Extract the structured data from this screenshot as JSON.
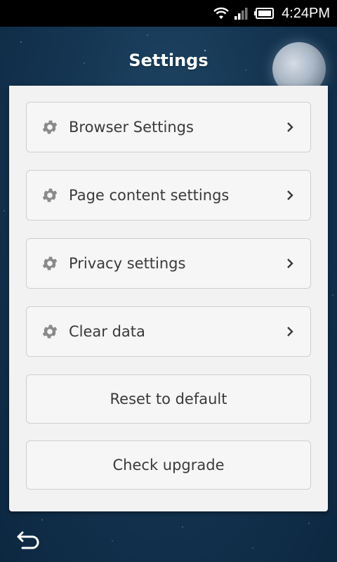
{
  "status_bar": {
    "time": "4:24PM",
    "icons": [
      "wifi-icon",
      "signal-icon",
      "battery-icon"
    ]
  },
  "header": {
    "title": "Settings"
  },
  "menu": {
    "items": [
      {
        "label": "Browser Settings",
        "icon": "gear-icon",
        "chevron": true
      },
      {
        "label": "Page content settings",
        "icon": "gear-icon",
        "chevron": true
      },
      {
        "label": "Privacy settings",
        "icon": "gear-icon",
        "chevron": true
      },
      {
        "label": "Clear data",
        "icon": "gear-icon",
        "chevron": true
      }
    ],
    "actions": [
      {
        "label": "Reset to default"
      },
      {
        "label": "Check upgrade"
      }
    ]
  },
  "nav": {
    "back_icon": "back-arrow-icon"
  },
  "colors": {
    "background": "#143552",
    "panel": "#f2f2f2",
    "text": "#3a3a3a",
    "icon": "#8a8a8a"
  }
}
